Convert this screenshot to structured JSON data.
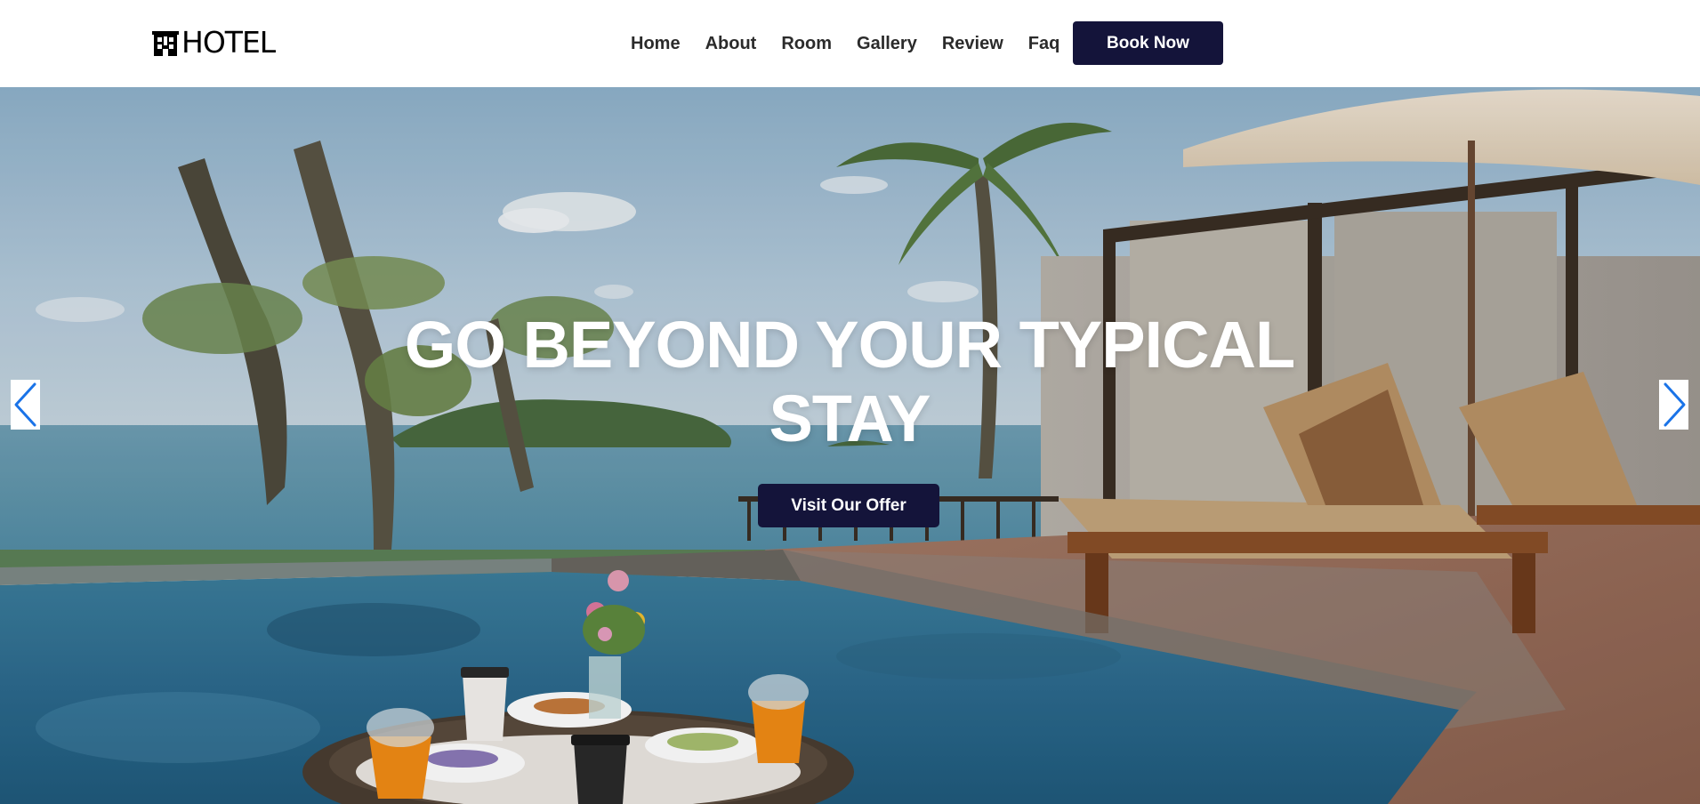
{
  "brand": {
    "name": "HOTEL",
    "icon": "hotel-building-icon"
  },
  "nav": {
    "items": [
      {
        "label": "Home"
      },
      {
        "label": "About"
      },
      {
        "label": "Room"
      },
      {
        "label": "Gallery"
      },
      {
        "label": "Review"
      },
      {
        "label": "Faq"
      }
    ],
    "cta_label": "Book Now"
  },
  "hero": {
    "title": "GO BEYOND YOUR TYPICAL STAY",
    "button_label": "Visit Our Offer",
    "prev_icon": "chevron-left-icon",
    "next_icon": "chevron-right-icon",
    "image": "poolside-sea-view-photo"
  },
  "colors": {
    "accent": "#14143a",
    "header_bg": "#ffffff",
    "nav_text": "#2b2b2b",
    "arrow": "#1a73e8",
    "hero_text": "#ffffff"
  }
}
